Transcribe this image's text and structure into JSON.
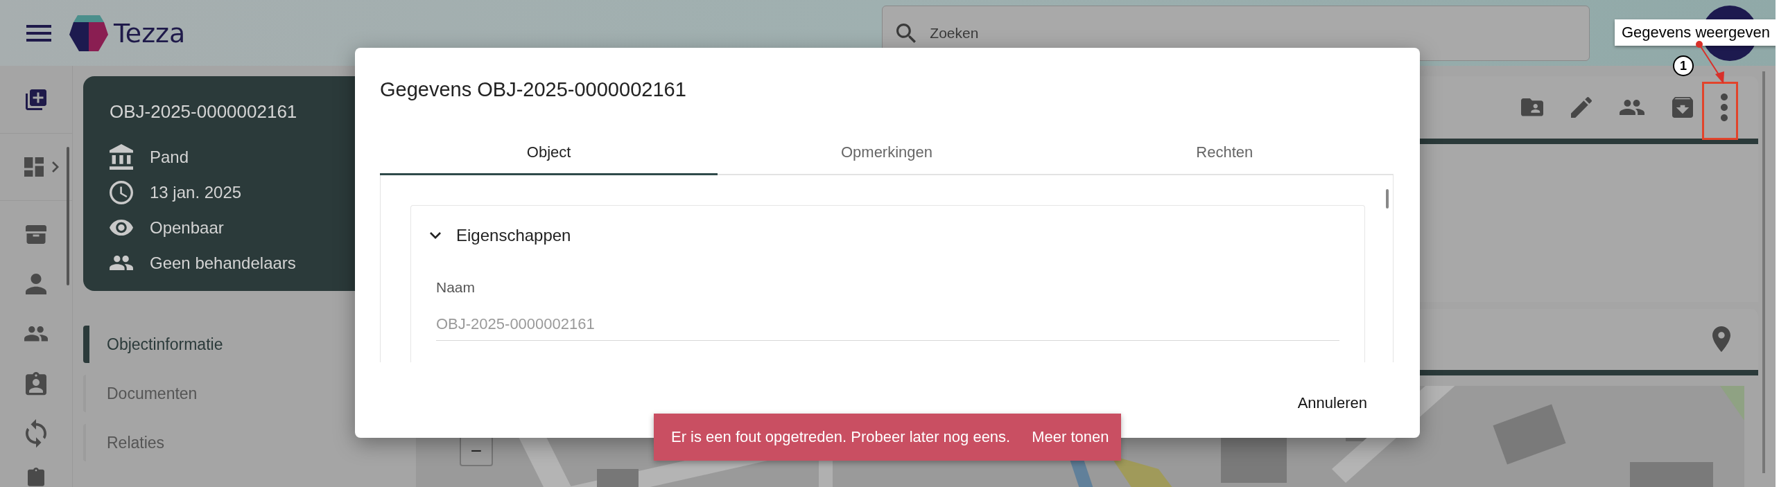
{
  "app": {
    "name": "Tezza"
  },
  "search": {
    "placeholder": "Zoeken"
  },
  "object_card": {
    "title": "OBJ-2025-0000002161",
    "details": [
      {
        "kind": "type",
        "text": "Pand"
      },
      {
        "kind": "date",
        "text": "13 jan. 2025"
      },
      {
        "kind": "visibility",
        "text": "Openbaar"
      },
      {
        "kind": "handlers",
        "text": "Geen behandelaars"
      }
    ]
  },
  "nav": [
    {
      "label": "Objectinformatie",
      "selected": true
    },
    {
      "label": "Documenten",
      "selected": false
    },
    {
      "label": "Relaties",
      "selected": false
    }
  ],
  "map": {
    "zoom_out": "−"
  },
  "dialog": {
    "title": "Gegevens OBJ-2025-0000002161",
    "tabs": [
      {
        "label": "Object",
        "selected": true
      },
      {
        "label": "Opmerkingen",
        "selected": false
      },
      {
        "label": "Rechten",
        "selected": false
      }
    ],
    "section": {
      "title": "Eigenschappen",
      "expanded": true
    },
    "fields": [
      {
        "label": "Naam",
        "value": "OBJ-2025-0000002161",
        "disabled": true
      }
    ],
    "buttons": [
      "Annuleren"
    ]
  },
  "snackbar": {
    "message": "Er is een fout opgetreden. Probeer later nog eens.",
    "action": "Meer tonen"
  },
  "annotation": {
    "number": "1",
    "label": "Gegevens weergeven"
  }
}
